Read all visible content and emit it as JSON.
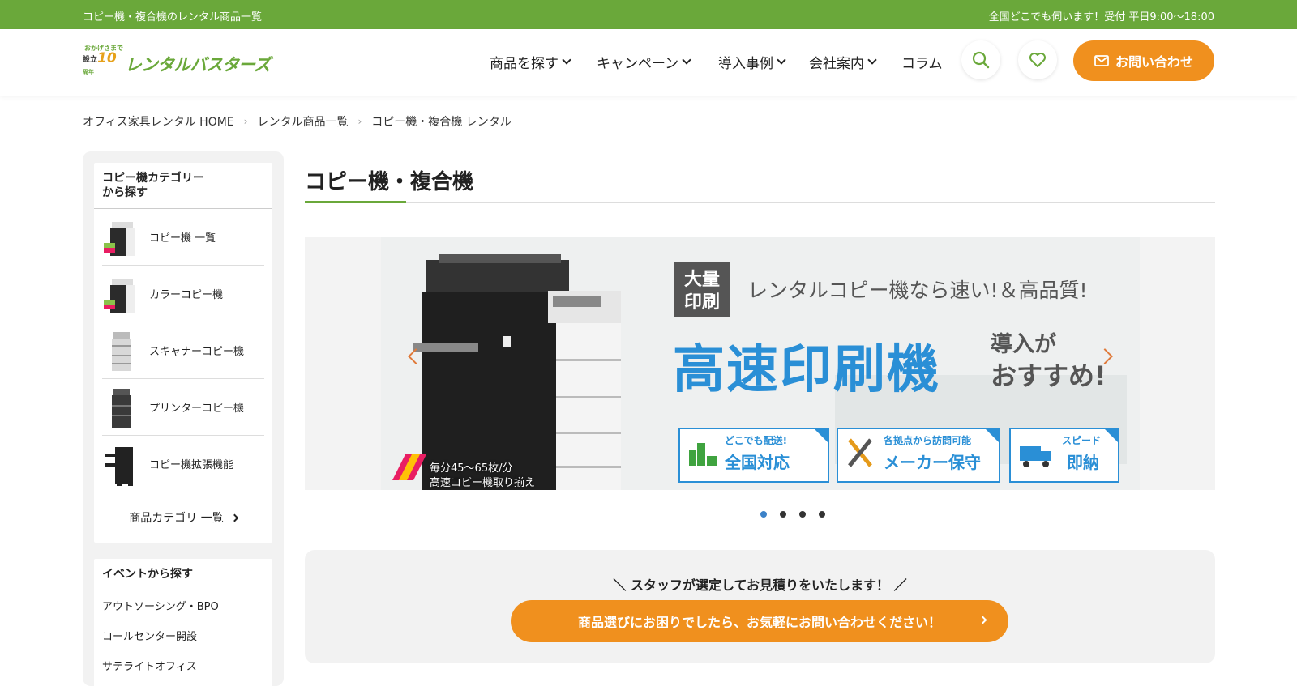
{
  "topbar": {
    "left": "コピー機・複合機のレンタル商品一覧",
    "right": "全国どこでも伺います！受付 平日9:00〜18:00"
  },
  "logo": {
    "badge_line1": "おかげさまで",
    "badge_line2": "設立",
    "badge_number": "10",
    "badge_line3": "周年",
    "name": "レンタルバスターズ"
  },
  "nav": {
    "items": [
      {
        "label": "商品を探す",
        "dropdown": true
      },
      {
        "label": "キャンペーン",
        "dropdown": true
      },
      {
        "label": "導入事例",
        "dropdown": true
      },
      {
        "label": "会社案内",
        "dropdown": true
      },
      {
        "label": "コラム",
        "dropdown": false
      }
    ],
    "search_icon": "search-icon",
    "favorite_icon": "heart-icon",
    "contact_label": "お問い合わせ"
  },
  "breadcrumb": {
    "items": [
      "オフィス家具レンタル HOME",
      "レンタル商品一覧",
      "コピー機・複合機 レンタル"
    ]
  },
  "sidebar": {
    "category_heading": "コピー機カテゴリー\nから探す",
    "categories": [
      "コピー機 一覧",
      "カラーコピー機",
      "スキャナーコピー機",
      "プリンターコピー機",
      "コピー機拡張機能"
    ],
    "more_label": "商品カテゴリ 一覧",
    "event_heading": "イベントから探す",
    "events": [
      "アウトソーシング・BPO",
      "コールセンター開設",
      "サテライトオフィス"
    ]
  },
  "main": {
    "title": "コピー機・複合機",
    "banner": {
      "tag_line1": "大量",
      "tag_line2": "印刷",
      "subhead": "レンタルコピー機なら速い!＆高品質!",
      "headline": "高速印刷機",
      "side_line1": "導入が",
      "side_line2": "おすすめ!",
      "speed_line1": "毎分45〜65枚/分",
      "speed_line2": "高速コピー機取り揃え",
      "features": [
        {
          "small": "どこでも配送!",
          "big": "全国対応"
        },
        {
          "small": "各拠点から訪問可能",
          "big": "メーカー保守"
        },
        {
          "small": "スピード",
          "big": "即納"
        }
      ]
    },
    "slider_dots": 4,
    "active_dot": 1
  },
  "cta": {
    "lead": "＼ スタッフが選定してお見積りをいたします！ ／",
    "button": "商品選びにお困りでしたら、お気軽にお問い合わせください！"
  },
  "colors": {
    "brand_green": "#6aa83a",
    "cta_orange": "#f0901e",
    "banner_blue": "#2a8fd6"
  }
}
